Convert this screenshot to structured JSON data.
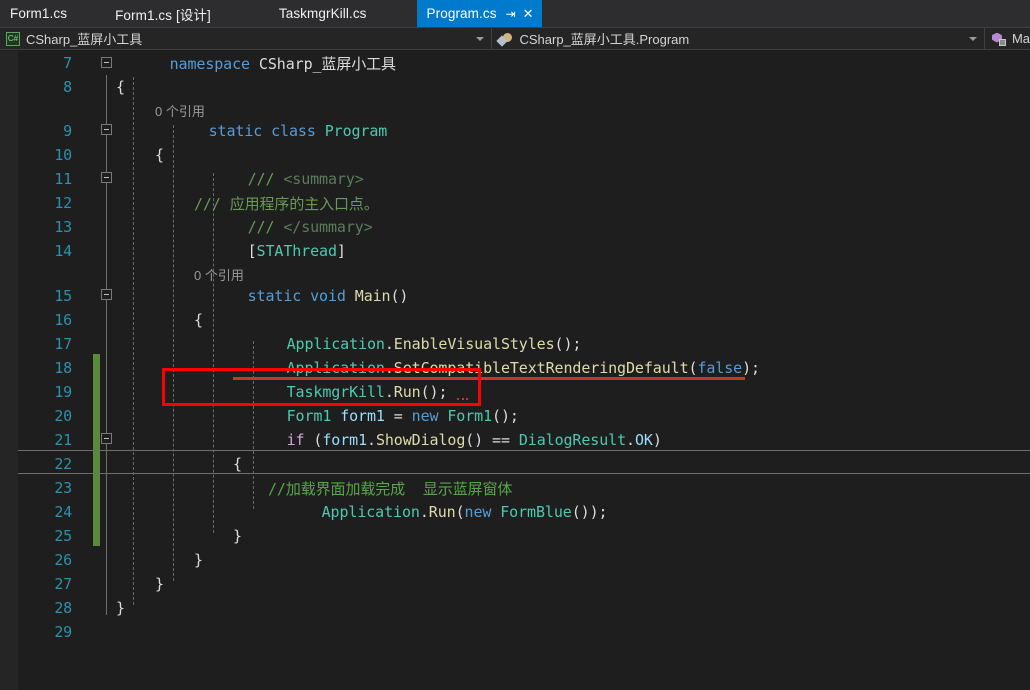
{
  "window": {
    "app": "Visual Studio",
    "theme": "dark"
  },
  "tabs": [
    {
      "label": "Form1.cs",
      "active": false,
      "icon": "document-icon"
    },
    {
      "label": "Form1.cs [设计]",
      "active": false,
      "icon": "designer-icon"
    },
    {
      "label": "TaskmgrKill.cs",
      "active": false,
      "icon": "document-icon"
    },
    {
      "label": "Program.cs",
      "active": true,
      "icon": "document-icon",
      "pin": "⇥",
      "close": "✕"
    }
  ],
  "nav_bar": {
    "project": {
      "icon": "csharp-project-icon",
      "text": "CSharp_蓝屏小工具",
      "arrow": "▾"
    },
    "type": {
      "icon": "class-icon",
      "text": "CSharp_蓝屏小工具.Program",
      "arrow": "▾"
    },
    "member": {
      "icon": "method-icon",
      "text": "Ma",
      "arrow": "▾"
    }
  },
  "editor": {
    "first_line": 7,
    "last_line": 29,
    "current_line": 22,
    "codelens": [
      {
        "after_line": 8,
        "text": "0 个引用"
      },
      {
        "after_line": 14,
        "text": "0 个引用"
      }
    ],
    "annotation": {
      "shape": "rectangle",
      "color": "#ff0000",
      "targets_line": 19,
      "targets_text": "TaskmgrKill.Run();"
    },
    "lines": [
      {
        "n": 7,
        "indent": 0,
        "text": "namespace CSharp_蓝屏小工具"
      },
      {
        "n": 8,
        "indent": 1,
        "text": "{"
      },
      {
        "n": 9,
        "indent": 1,
        "text": "static class Program"
      },
      {
        "n": 10,
        "indent": 2,
        "text": "{"
      },
      {
        "n": 11,
        "indent": 2,
        "text": "/// <summary>"
      },
      {
        "n": 12,
        "indent": 2,
        "text": "/// 应用程序的主入口点。"
      },
      {
        "n": 13,
        "indent": 2,
        "text": "/// </summary>"
      },
      {
        "n": 14,
        "indent": 2,
        "text": "[STAThread]"
      },
      {
        "n": 15,
        "indent": 2,
        "text": "static void Main()"
      },
      {
        "n": 16,
        "indent": 2,
        "text": "{"
      },
      {
        "n": 17,
        "indent": 3,
        "text": "Application.EnableVisualStyles();"
      },
      {
        "n": 18,
        "indent": 3,
        "text": "Application.SetCompatibleTextRenderingDefault(false);"
      },
      {
        "n": 19,
        "indent": 3,
        "text": "TaskmgrKill.Run();"
      },
      {
        "n": 20,
        "indent": 3,
        "text": "Form1 form1 = new Form1();"
      },
      {
        "n": 21,
        "indent": 3,
        "text": "if (form1.ShowDialog() == DialogResult.OK)"
      },
      {
        "n": 22,
        "indent": 3,
        "text": "{"
      },
      {
        "n": 23,
        "indent": 4,
        "text": "//加载界面加载完成  显示蓝屏窗体"
      },
      {
        "n": 24,
        "indent": 4,
        "text": "Application.Run(new FormBlue());"
      },
      {
        "n": 25,
        "indent": 3,
        "text": "}"
      },
      {
        "n": 26,
        "indent": 2,
        "text": "}"
      },
      {
        "n": 27,
        "indent": 1,
        "text": "}"
      },
      {
        "n": 28,
        "indent": 0,
        "text": "}"
      },
      {
        "n": 29,
        "indent": 0,
        "text": ""
      }
    ]
  },
  "colors": {
    "editor_background": "#1e1e1e",
    "tab_bar_background": "#2d2d30",
    "active_tab": "#007acc",
    "nav_bar_background": "#252526",
    "line_number": "#2b91af",
    "keyword": "#569cd6",
    "control_keyword": "#d8a0df",
    "type": "#4ec9b0",
    "method": "#dcdcaa",
    "variable": "#9cdcfe",
    "comment": "#57a64a",
    "doc_comment": "#6a9955",
    "changed_line_marker": "#5a8a3c",
    "error_squiggle": "#c0392b",
    "annotation": "#ff0000"
  }
}
